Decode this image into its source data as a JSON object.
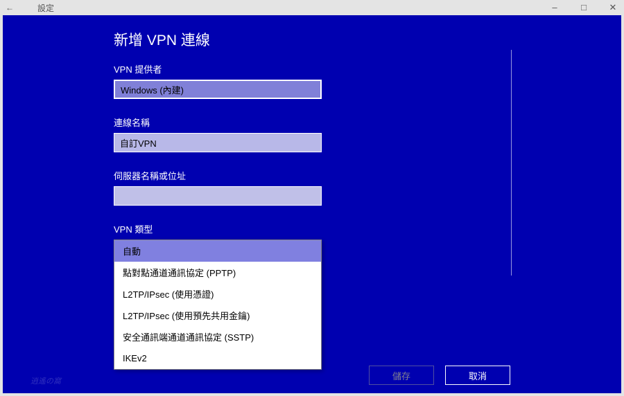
{
  "window": {
    "title": "設定"
  },
  "dialog": {
    "title": "新增 VPN 連線",
    "provider": {
      "label": "VPN 提供者",
      "value": "Windows (內建)"
    },
    "name": {
      "label": "連線名稱",
      "value": "自訂VPN"
    },
    "server": {
      "label": "伺服器名稱或位址",
      "value": ""
    },
    "vpntype": {
      "label": "VPN 類型",
      "selected_index": 0,
      "options": [
        "自動",
        "點對點通道通訊協定 (PPTP)",
        "L2TP/IPsec (使用憑證)",
        "L2TP/IPsec (使用預先共用金鑰)",
        "安全通訊端通道通訊協定 (SSTP)",
        "IKEv2"
      ]
    },
    "buttons": {
      "save": "儲存",
      "cancel": "取消"
    }
  }
}
